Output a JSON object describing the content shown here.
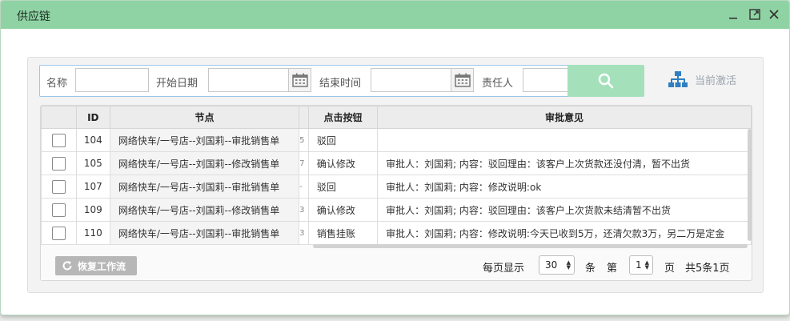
{
  "window": {
    "title": "供应链"
  },
  "search": {
    "name_label": "名称",
    "name_value": "",
    "start_label": "开始日期",
    "start_value": "",
    "end_label": "结束时间",
    "end_value": "",
    "owner_label": "责任人",
    "owner_value": ""
  },
  "toolbar": {
    "active_label": "当前激活"
  },
  "table": {
    "headers": {
      "id": "ID",
      "node": "节点",
      "action": "点击按钮",
      "opinion": "审批意见"
    },
    "rows": [
      {
        "id": "104",
        "node": "网络快车/一号店--刘国莉--审批销售单",
        "gap": "5",
        "action": "驳回",
        "opinion": ""
      },
      {
        "id": "105",
        "node": "网络快车/一号店--刘国莉--修改销售单",
        "gap": "7",
        "action": "确认修改",
        "opinion": "审批人：刘国莉; 内容：驳回理由：该客户上次货款还没付清，暂不出货"
      },
      {
        "id": "107",
        "node": "网络快车/一号店--刘国莉--审批销售单",
        "gap": "-",
        "action": "驳回",
        "opinion": "审批人：刘国莉; 内容：修改说明:ok"
      },
      {
        "id": "109",
        "node": "网络快车/一号店--刘国莉--修改销售单",
        "gap": "3",
        "action": "确认修改",
        "opinion": "审批人：刘国莉; 内容：驳回理由：该客户上次货款未结清暂不出货"
      },
      {
        "id": "110",
        "node": "网络快车/一号店--刘国莉--审批销售单",
        "gap": "3",
        "action": "销售挂账",
        "opinion": "审批人：刘国莉; 内容：修改说明:今天已收到5万，还清欠款3万，另二万是定金"
      }
    ]
  },
  "footer": {
    "restore_label": "恢复工作流",
    "per_page_label": "每页显示",
    "per_page_value": "30",
    "rows_unit": "条",
    "page_prefix": "第",
    "page_value": "1",
    "page_unit": "页",
    "total_text": "共5条1页"
  },
  "colors": {
    "titlebar": "#8fd3a4",
    "search_button": "#a4e1bb",
    "accent_blue": "#2f7fc1"
  }
}
